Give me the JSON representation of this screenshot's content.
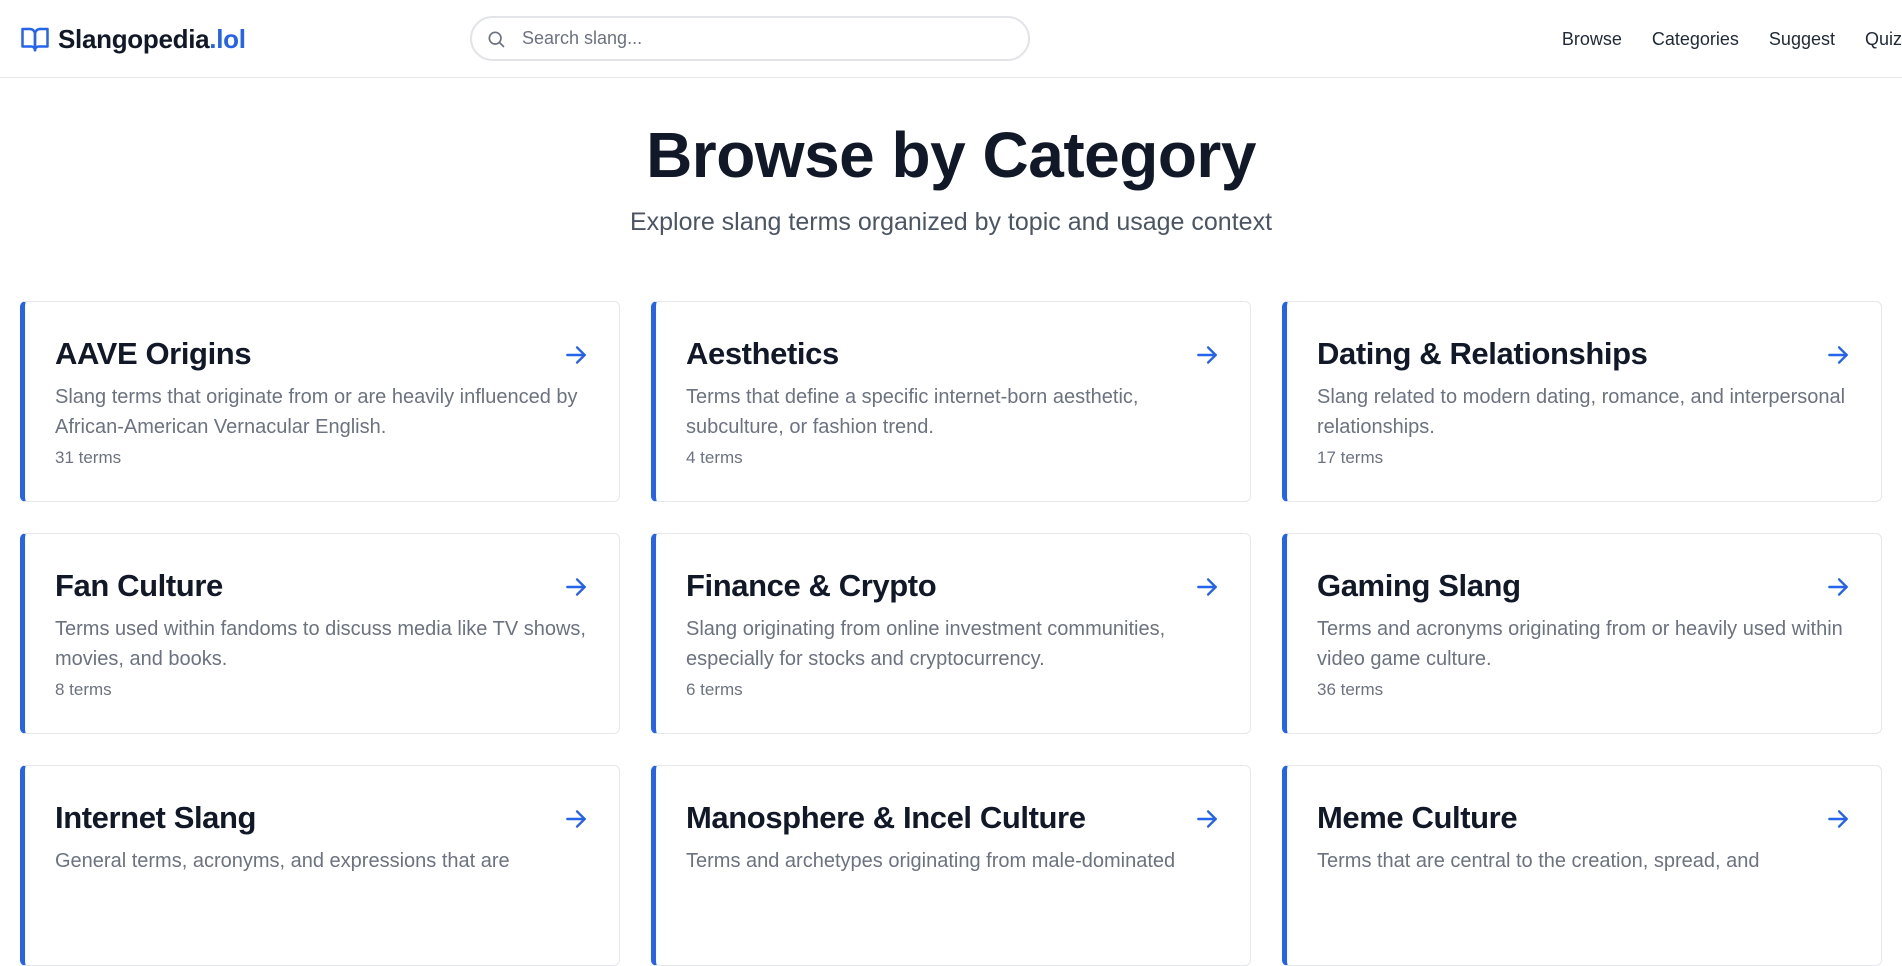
{
  "header": {
    "logo_main": "Slangopedia",
    "logo_tld": ".lol",
    "search_placeholder": "Search slang...",
    "nav": [
      {
        "label": "Browse"
      },
      {
        "label": "Categories"
      },
      {
        "label": "Suggest"
      },
      {
        "label": "Quiz"
      }
    ]
  },
  "hero": {
    "title": "Browse by Category",
    "subtitle": "Explore slang terms organized by topic and usage context"
  },
  "colors": {
    "accent": "#2563eb",
    "text_primary": "#111827",
    "text_muted": "#6b7280"
  },
  "categories": [
    {
      "name": "AAVE Origins",
      "description": "Slang terms that originate from or are heavily influenced by African-American Vernacular English.",
      "count": "31 terms"
    },
    {
      "name": "Aesthetics",
      "description": "Terms that define a specific internet-born aesthetic, subculture, or fashion trend.",
      "count": "4 terms"
    },
    {
      "name": "Dating & Relationships",
      "description": "Slang related to modern dating, romance, and interpersonal relationships.",
      "count": "17 terms"
    },
    {
      "name": "Fan Culture",
      "description": "Terms used within fandoms to discuss media like TV shows, movies, and books.",
      "count": "8 terms"
    },
    {
      "name": "Finance & Crypto",
      "description": "Slang originating from online investment communities, especially for stocks and cryptocurrency.",
      "count": "6 terms"
    },
    {
      "name": "Gaming Slang",
      "description": "Terms and acronyms originating from or heavily used within video game culture.",
      "count": "36 terms"
    },
    {
      "name": "Internet Slang",
      "description": "General terms, acronyms, and expressions that are",
      "count": ""
    },
    {
      "name": "Manosphere & Incel Culture",
      "description": "Terms and archetypes originating from male-dominated",
      "count": ""
    },
    {
      "name": "Meme Culture",
      "description": "Terms that are central to the creation, spread, and",
      "count": ""
    }
  ]
}
